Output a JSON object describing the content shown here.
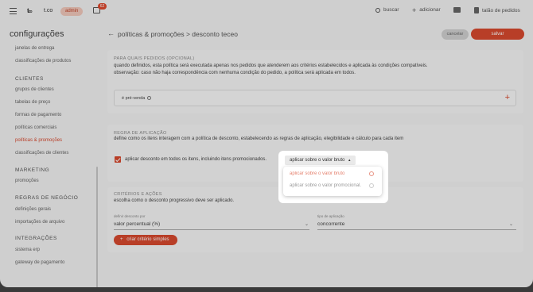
{
  "topbar": {
    "brand": "t.co",
    "badge": "admin",
    "chat_count": "62",
    "search": "buscar",
    "add": "adicionar",
    "orders": "talão de pedidos"
  },
  "sidebar": {
    "title": "configurações",
    "items_top": [
      "janelas de entrega",
      "classificações de produtos"
    ],
    "section_clients": "CLIENTES",
    "clients": [
      "grupos de clientes",
      "tabelas de preço",
      "formas de pagamento",
      "políticas comerciais",
      "políticas & promoções",
      "classificações de clientes"
    ],
    "section_marketing": "MARKETING",
    "marketing": [
      "promoções"
    ],
    "section_rules": "REGRAS DE NEGÓCIO",
    "rules": [
      "definições gerais",
      "importações de arquivo"
    ],
    "section_integrations": "INTEGRAÇÕES",
    "integrations": [
      "sistema erp",
      "gateway de pagamento"
    ]
  },
  "header": {
    "title": "políticas & promoções > desconto teceo",
    "cancel": "cancelar",
    "save": "salvar"
  },
  "orders_section": {
    "label": "PARA QUAIS PEDIDOS (OPCIONAL)",
    "line1": "quando definidos, esta política será executada apenas nos pedidos que atenderem aos critérios estabelecidos e aplicada às condições compatíveis.",
    "line2": "observação: caso não haja correspondência com nenhuma condição do pedido, a política será aplicada em todos.",
    "chip": "é pré-venda"
  },
  "apply_section": {
    "label": "REGRA DE APLICAÇÃO",
    "desc": "define como os itens interagem com a política de desconto, estabelecendo as regras de aplicação, elegibilidade e cálculo para cada item",
    "checkbox": "aplicar desconto em todos os itens, incluindo itens promocionados."
  },
  "criteria_section": {
    "label": "CRITÉRIOS E AÇÕES",
    "desc": "escolha como o desconto progressivo deve ser aplicado.",
    "field1_label": "definir desconto por",
    "field1_value": "valor percentual (%)",
    "field2_label": "tipo de aplicação",
    "field2_value": "concorrente",
    "button": "criar critério simples"
  },
  "dropdown": {
    "selected": "aplicar sobre o valor bruto",
    "options": [
      "aplicar sobre o valor bruto",
      "aplicar sobre o valor promocional."
    ]
  },
  "colors": {
    "accent": "#d9492e",
    "badge_bg": "#f3c9bd"
  }
}
